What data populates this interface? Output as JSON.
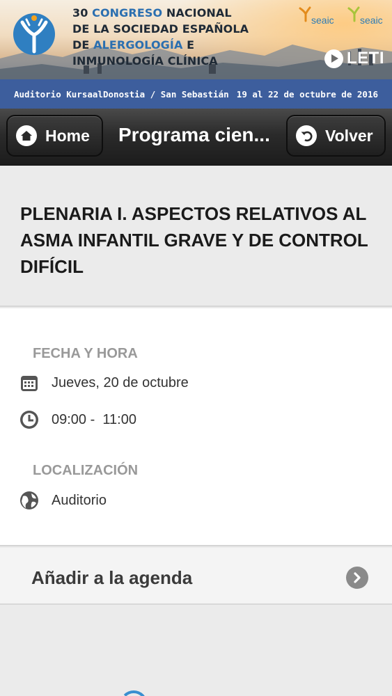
{
  "banner": {
    "congress_line1_num": "30 ",
    "congress_line1_hl": "CONGRESO",
    "congress_line1_rest": " NACIONAL",
    "congress_line2": "DE LA SOCIEDAD ESPAÑOLA",
    "congress_line3_hl": "ALERGOLOGÍA",
    "congress_line3_pre": "DE ",
    "congress_line3_post": " E",
    "congress_line4": "INMUNOLOGÍA CLÍNICA",
    "sponsor_1": "seaic",
    "sponsor_2": "seaic",
    "sponsor_3": "LETI",
    "accent_color": "#2b6fb0"
  },
  "info_strip": {
    "venue": "Auditorio Kursaal",
    "city": "Donostia / San Sebastián",
    "dates": "19 al 22 de octubre de 2016",
    "background": "#3d5e9d"
  },
  "navbar": {
    "home_label": "Home",
    "title": "Programa cien...",
    "back_label": "Volver",
    "home_icon": "home-icon",
    "back_icon": "undo-arrow-icon"
  },
  "session": {
    "title": "PLENARIA I. ASPECTOS RELATIVOS AL ASMA INFANTIL GRAVE Y DE CONTROL DIFÍCIL"
  },
  "details": {
    "datetime_label": "FECHA Y HORA",
    "date": "Jueves, 20 de octubre",
    "time": "09:00 -  11:00",
    "location_label": "LOCALIZACIÓN",
    "location": "Auditorio",
    "icons": [
      "calendar-icon",
      "clock-icon",
      "globe-icon"
    ]
  },
  "actions": {
    "add_to_agenda": "Añadir a la agenda"
  }
}
